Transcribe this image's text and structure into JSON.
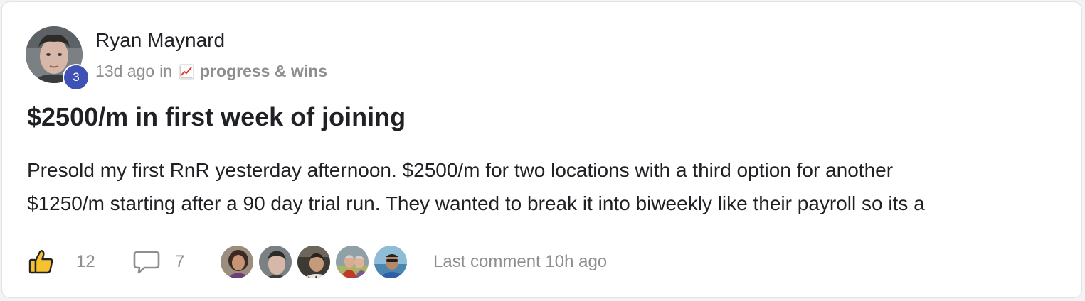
{
  "post": {
    "author": {
      "name": "Ryan Maynard",
      "level": "3"
    },
    "meta": {
      "time": "13d ago",
      "in_label": "in",
      "category_icon": "chart-increasing-emoji",
      "category": "progress & wins"
    },
    "title": "$2500/m in first week of joining",
    "body_lines": [
      "Presold my first RnR yesterday afternoon. $2500/m for two locations with a third option for another",
      "$1250/m starting after a 90 day trial run. They wanted to break it into biweekly like their payroll so its a"
    ],
    "footer": {
      "like_icon": "thumbs-up-icon",
      "like_count": "12",
      "comment_icon": "speech-bubble-icon",
      "comment_count": "7",
      "last_comment": "Last comment 10h ago"
    }
  },
  "colors": {
    "badge": "#3f51b5",
    "muted_text": "#8e8e8e",
    "primary_text": "#202124",
    "like_fill": "#f5c12e"
  }
}
